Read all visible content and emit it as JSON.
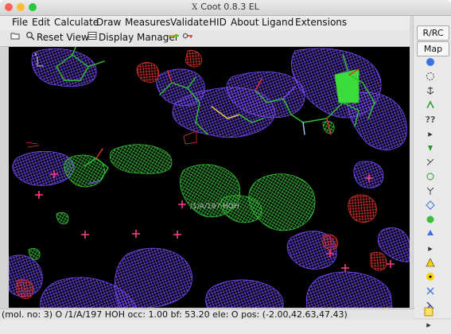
{
  "window": {
    "title": "Coot 0.8.3 EL",
    "traffic_lights": [
      "#ff5f57",
      "#febc2e",
      "#28c840"
    ]
  },
  "menubar": {
    "items": [
      "File",
      "Edit",
      "Calculate",
      "Draw",
      "Measures",
      "Validate",
      "HID",
      "About",
      "Ligand",
      "Extensions"
    ]
  },
  "toolbar": {
    "reset_view_label": "Reset View",
    "display_manager_label": "Display Manager",
    "icons": [
      "folder-icon",
      "magnifier-icon",
      "display-manager-icon",
      "arrow-key-icon",
      "key-icon"
    ]
  },
  "right_toolbar": {
    "rrc_label": "R/RC",
    "map_label": "Map"
  },
  "viewport": {
    "label": "/1/A/197 HOH",
    "colors": {
      "blue_mesh": "#7a4cff",
      "green_mesh": "#36c736",
      "red_mesh": "#e0322a",
      "waters": "#ff3b8a",
      "bonds": "#2cc52c"
    }
  },
  "status": {
    "text": "(mol. no: 3)  O  /1/A/197 HOH occ:  1.00 bf: 53.20 ele:  O pos: (-2.00,42.63,47.43)"
  }
}
